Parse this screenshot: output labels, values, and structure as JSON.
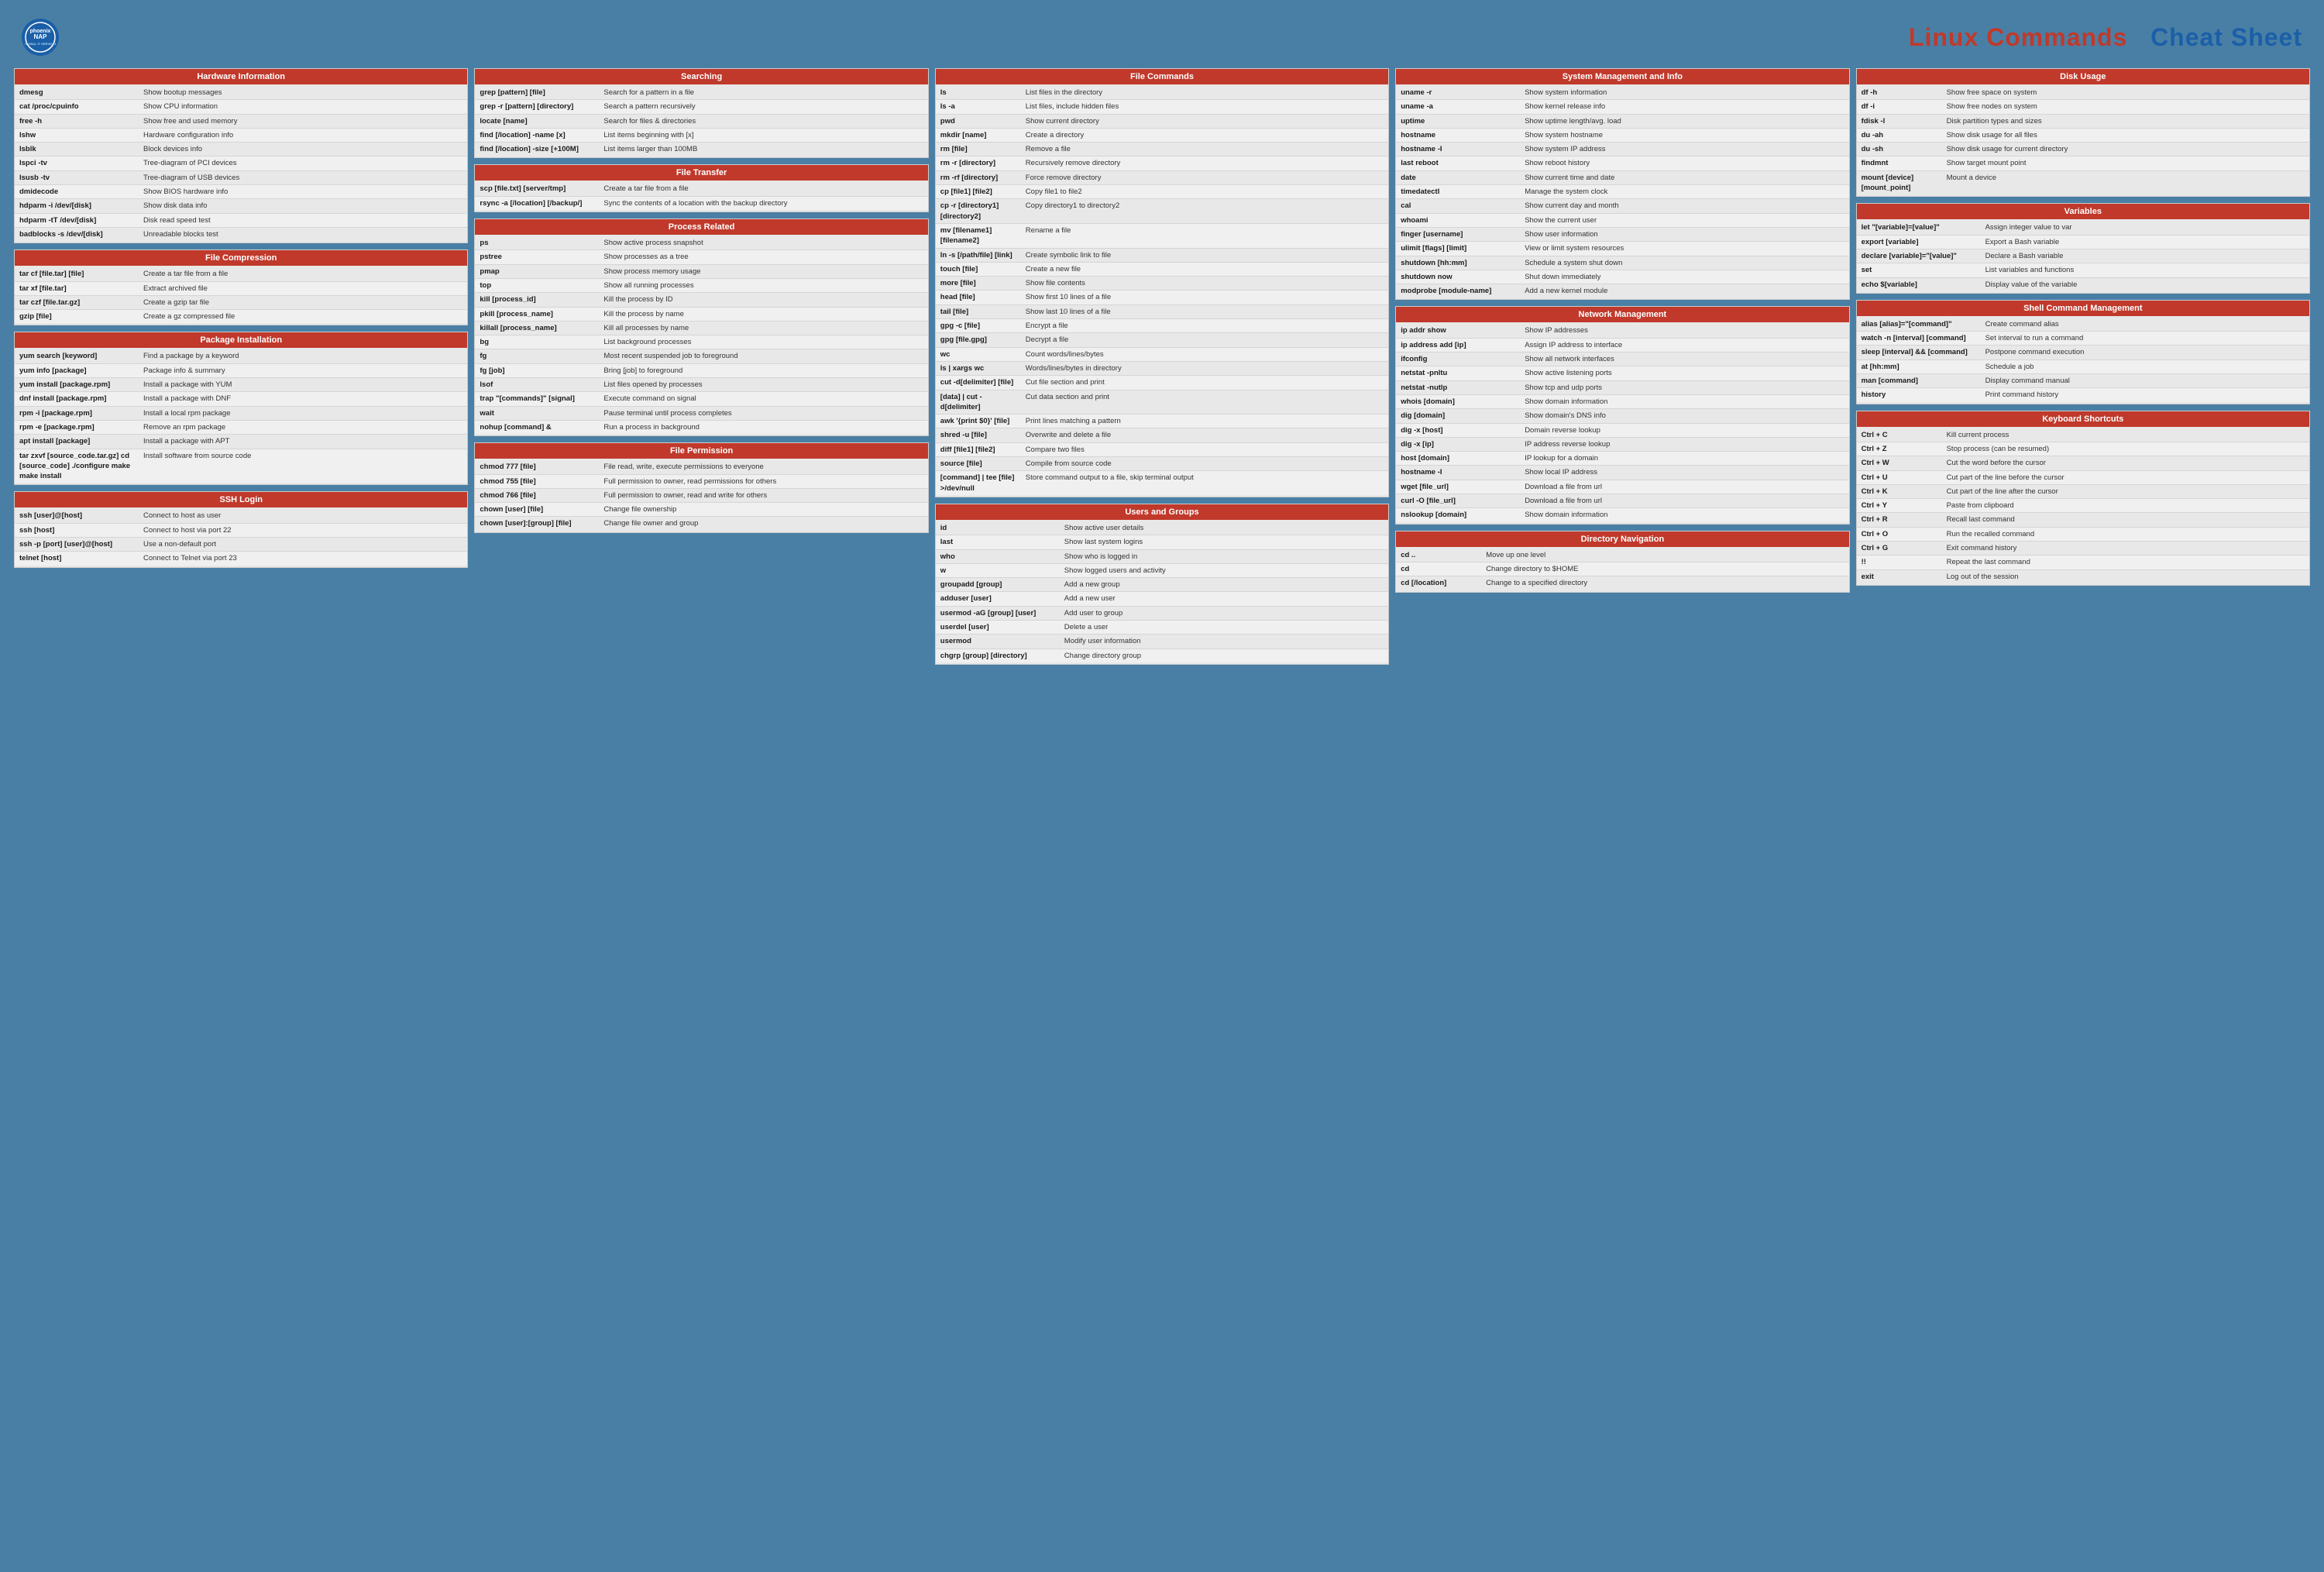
{
  "header": {
    "logo_text": "phoenixNAP",
    "logo_sub": "GLOBAL IT SERVICES",
    "title_red": "Linux Commands",
    "title_blue": "Cheat Sheet"
  },
  "sections": {
    "hardware": {
      "title": "Hardware Information",
      "rows": [
        [
          "dmesg",
          "Show bootup messages"
        ],
        [
          "cat /proc/cpuinfo",
          "Show CPU information"
        ],
        [
          "free -h",
          "Show free and used memory"
        ],
        [
          "lshw",
          "Hardware configuration info"
        ],
        [
          "lsblk",
          "Block devices info"
        ],
        [
          "lspci -tv",
          "Tree-diagram of PCI devices"
        ],
        [
          "lsusb -tv",
          "Tree-diagram of USB devices"
        ],
        [
          "dmidecode",
          "Show BIOS hardware info"
        ],
        [
          "hdparm -i /dev/[disk]",
          "Show disk data info"
        ],
        [
          "hdparm -tT /dev/[disk]",
          "Disk read speed test"
        ],
        [
          "badblocks -s /dev/[disk]",
          "Unreadable blocks test"
        ]
      ]
    },
    "searching": {
      "title": "Searching",
      "rows": [
        [
          "grep [pattern] [file]",
          "Search for a pattern in a file"
        ],
        [
          "grep -r [pattern] [directory]",
          "Search a pattern recursively"
        ],
        [
          "locate [name]",
          "Search for files & directories"
        ],
        [
          "find [/location] -name [x]",
          "List items beginning with [x]"
        ],
        [
          "find [/location] -size [+100M]",
          "List items larger than 100MB"
        ]
      ]
    },
    "file_commands": {
      "title": "File Commands",
      "rows": [
        [
          "ls",
          "List files in the directory"
        ],
        [
          "ls -a",
          "List files, include hidden files"
        ],
        [
          "pwd",
          "Show current directory"
        ],
        [
          "mkdir [name]",
          "Create a directory"
        ],
        [
          "rm [file]",
          "Remove a file"
        ],
        [
          "rm -r [directory]",
          "Recursively remove directory"
        ],
        [
          "rm -rf [directory]",
          "Force remove directory"
        ],
        [
          "cp [file1] [file2]",
          "Copy file1 to file2"
        ],
        [
          "cp -r [directory1] [directory2]",
          "Copy directory1 to directory2"
        ],
        [
          "mv [filename1] [filename2]",
          "Rename a file"
        ],
        [
          "ln -s [/path/file] [link]",
          "Create symbolic link to file"
        ],
        [
          "touch [file]",
          "Create a new file"
        ],
        [
          "more [file]",
          "Show file contents"
        ],
        [
          "head [file]",
          "Show first 10 lines of a file"
        ],
        [
          "tail [file]",
          "Show last 10 lines of a file"
        ],
        [
          "gpg -c [file]",
          "Encrypt a file"
        ],
        [
          "gpg [file.gpg]",
          "Decrypt a file"
        ],
        [
          "wc",
          "Count words/lines/bytes"
        ],
        [
          "ls | xargs wc",
          "Words/lines/bytes in directory"
        ],
        [
          "cut -d[delimiter] [file]",
          "Cut file section and print"
        ],
        [
          "[data] | cut -d[delimiter]",
          "Cut data section and print"
        ],
        [
          "awk '{print $0}' [file]",
          "Print lines matching a pattern"
        ],
        [
          "shred -u [file]",
          "Overwrite and delete a file"
        ],
        [
          "diff [file1] [file2]",
          "Compare two files"
        ],
        [
          "source [file]",
          "Compile from source code"
        ],
        [
          "[command] | tee [file] >/dev/null",
          "Store command output to a file, skip terminal output"
        ]
      ]
    },
    "system": {
      "title": "System Management and Info",
      "rows": [
        [
          "uname -r",
          "Show system information"
        ],
        [
          "uname -a",
          "Show kernel release info"
        ],
        [
          "uptime",
          "Show uptime length/avg. load"
        ],
        [
          "hostname",
          "Show system hostname"
        ],
        [
          "hostname -I",
          "Show system IP address"
        ],
        [
          "last reboot",
          "Show reboot history"
        ],
        [
          "date",
          "Show current time and date"
        ],
        [
          "timedatectl",
          "Manage the system clock"
        ],
        [
          "cal",
          "Show current day and month"
        ],
        [
          "whoami",
          "Show the current user"
        ],
        [
          "finger [username]",
          "Show user information"
        ],
        [
          "ulimit [flags] [limit]",
          "View or limit system resources"
        ],
        [
          "shutdown [hh:mm]",
          "Schedule a system shut down"
        ],
        [
          "shutdown now",
          "Shut down immediately"
        ],
        [
          "modprobe [module-name]",
          "Add a new kernel module"
        ]
      ]
    },
    "disk_usage": {
      "title": "Disk Usage",
      "rows": [
        [
          "df -h",
          "Show free space on system"
        ],
        [
          "df -i",
          "Show free nodes on system"
        ],
        [
          "fdisk -l",
          "Disk partition types and sizes"
        ],
        [
          "du -ah",
          "Show disk usage for all files"
        ],
        [
          "du -sh",
          "Show disk usage for current directory"
        ],
        [
          "findmnt",
          "Show target mount point"
        ],
        [
          "mount [device] [mount_point]",
          "Mount a device"
        ]
      ]
    },
    "file_compression": {
      "title": "File Compression",
      "rows": [
        [
          "tar cf [file.tar] [file]",
          "Create a tar file from a file"
        ],
        [
          "tar xf [file.tar]",
          "Extract archived file"
        ],
        [
          "tar czf [file.tar.gz]",
          "Create a gzip tar file"
        ],
        [
          "gzip [file]",
          "Create a gz compressed file"
        ]
      ]
    },
    "file_transfer": {
      "title": "File Transfer",
      "rows": [
        [
          "scp [file.txt] [server/tmp]",
          "Create a tar file from a file"
        ],
        [
          "rsync -a [/location] [/backup/]",
          "Sync the contents of a location with the backup directory"
        ]
      ]
    },
    "process": {
      "title": "Process Related",
      "rows": [
        [
          "ps",
          "Show active process snapshot"
        ],
        [
          "pstree",
          "Show processes as a tree"
        ],
        [
          "pmap",
          "Show process memory usage"
        ],
        [
          "top",
          "Show all running processes"
        ],
        [
          "kill [process_id]",
          "Kill the process by ID"
        ],
        [
          "pkill [process_name]",
          "Kill the process by name"
        ],
        [
          "killall [process_name]",
          "Kill all processes by name"
        ],
        [
          "bg",
          "List background processes"
        ],
        [
          "fg",
          "Most recent suspended job to foreground"
        ],
        [
          "fg [job]",
          "Bring [job] to foreground"
        ],
        [
          "lsof",
          "List files opened by processes"
        ],
        [
          "trap \"[commands]\" [signal]",
          "Execute command on signal"
        ],
        [
          "wait",
          "Pause terminal until process completes"
        ],
        [
          "nohup [command] &",
          "Run a process in background"
        ]
      ]
    },
    "users_groups": {
      "title": "Users and Groups",
      "rows": [
        [
          "id",
          "Show active user details"
        ],
        [
          "last",
          "Show last system logins"
        ],
        [
          "who",
          "Show who is logged in"
        ],
        [
          "w",
          "Show logged users and activity"
        ],
        [
          "groupadd [group]",
          "Add a new group"
        ],
        [
          "adduser [user]",
          "Add a new user"
        ],
        [
          "usermod -aG [group] [user]",
          "Add user to group"
        ],
        [
          "userdel [user]",
          "Delete a user"
        ],
        [
          "usermod",
          "Modify user information"
        ],
        [
          "chgrp [group] [directory]",
          "Change directory group"
        ]
      ]
    },
    "variables": {
      "title": "Variables",
      "rows": [
        [
          "let \"[variable]=[value]\"",
          "Assign integer value to var"
        ],
        [
          "export [variable]",
          "Export a Bash variable"
        ],
        [
          "declare [variable]=\"[value]\"",
          "Declare a Bash variable"
        ],
        [
          "set",
          "List variables and functions"
        ],
        [
          "echo $[variable]",
          "Display value of the variable"
        ]
      ]
    },
    "network": {
      "title": "Network Management",
      "rows": [
        [
          "ip addr show",
          "Show IP addresses"
        ],
        [
          "ip address add [ip]",
          "Assign IP address to interface"
        ],
        [
          "ifconfig",
          "Show all network interfaces"
        ],
        [
          "netstat -pnltu",
          "Show active listening ports"
        ],
        [
          "netstat -nutlp",
          "Show tcp and udp ports"
        ],
        [
          "whois [domain]",
          "Show domain information"
        ],
        [
          "dig [domain]",
          "Show domain's DNS info"
        ],
        [
          "dig -x [host]",
          "Domain reverse lookup"
        ],
        [
          "dig -x [ip]",
          "IP address reverse lookup"
        ],
        [
          "host [domain]",
          "IP lookup for a domain"
        ],
        [
          "hostname -I",
          "Show local IP address"
        ],
        [
          "wget [file_url]",
          "Download a file from url"
        ],
        [
          "curl -O [file_url]",
          "Download a file from url"
        ],
        [
          "nslookup [domain]",
          "Show domain information"
        ]
      ]
    },
    "shell_cmd": {
      "title": "Shell Command Management",
      "rows": [
        [
          "alias [alias]=\"[command]\"",
          "Create command alias"
        ],
        [
          "watch -n [interval] [command]",
          "Set interval to run a command"
        ],
        [
          "sleep [interval] && [command]",
          "Postpone command execution"
        ],
        [
          "at [hh:mm]",
          "Schedule a job"
        ],
        [
          "man [command]",
          "Display command manual"
        ],
        [
          "history",
          "Print command history"
        ]
      ]
    },
    "package": {
      "title": "Package Installation",
      "rows": [
        [
          "yum search [keyword]",
          "Find a package by a keyword"
        ],
        [
          "yum info [package]",
          "Package info & summary"
        ],
        [
          "yum install [package.rpm]",
          "Install a package with YUM"
        ],
        [
          "dnf install [package.rpm]",
          "Install a package with DNF"
        ],
        [
          "rpm -i [package.rpm]",
          "Install a local rpm package"
        ],
        [
          "rpm -e [package.rpm]",
          "Remove an rpm package"
        ],
        [
          "apt install [package]",
          "Install a package with APT"
        ],
        [
          "tar zxvf [source_code.tar.gz] cd [source_code] ./configure make make install",
          "Install software from source code"
        ]
      ]
    },
    "file_perm": {
      "title": "File Permission",
      "rows": [
        [
          "chmod 777 [file]",
          "File read, write, execute permissions to everyone"
        ],
        [
          "chmod 755 [file]",
          "Full permission to owner, read permissions for others"
        ],
        [
          "chmod 766 [file]",
          "Full permission to owner, read and write for others"
        ],
        [
          "chown [user] [file]",
          "Change file ownership"
        ],
        [
          "chown [user]:[group] [file]",
          "Change file owner and group"
        ]
      ]
    },
    "directory": {
      "title": "Directory Navigation",
      "rows": [
        [
          "cd ..",
          "Move up one level"
        ],
        [
          "cd",
          "Change directory to $HOME"
        ],
        [
          "cd [/location]",
          "Change to a specified directory"
        ]
      ]
    },
    "ssh": {
      "title": "SSH Login",
      "rows": [
        [
          "ssh [user]@[host]",
          "Connect to host as user"
        ],
        [
          "ssh [host]",
          "Connect to host via port 22"
        ],
        [
          "ssh -p [port] [user]@[host]",
          "Use a non-default port"
        ],
        [
          "telnet [host]",
          "Connect to Telnet via port 23"
        ]
      ]
    },
    "keyboard": {
      "title": "Keyboard Shortcuts",
      "rows": [
        [
          "Ctrl + C",
          "Kill current process"
        ],
        [
          "Ctrl + Z",
          "Stop process (can be resumed)"
        ],
        [
          "Ctrl + W",
          "Cut the word before the cursor"
        ],
        [
          "Ctrl + U",
          "Cut part of the line before the cursor"
        ],
        [
          "Ctrl + K",
          "Cut part of the line after the cursor"
        ],
        [
          "Ctrl + Y",
          "Paste from clipboard"
        ],
        [
          "Ctrl + R",
          "Recall last command"
        ],
        [
          "Ctrl + O",
          "Run the recalled command"
        ],
        [
          "Ctrl + G",
          "Exit command history"
        ],
        [
          "!!",
          "Repeat the last command"
        ],
        [
          "exit",
          "Log out of the session"
        ]
      ]
    }
  }
}
